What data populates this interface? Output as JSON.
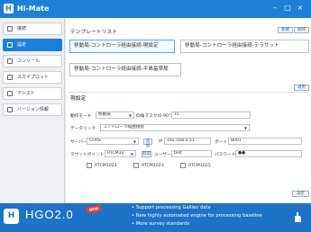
{
  "app": {
    "title": "Hi-Mate",
    "icon_label": "H"
  },
  "window_controls": {
    "minimize": "–",
    "maximize": "□",
    "close": "×"
  },
  "sidebar": {
    "items": [
      {
        "label": "接続"
      },
      {
        "label": "設定"
      },
      {
        "label": "コンソール"
      },
      {
        "label": "スカイプロット"
      },
      {
        "label": "アシスト"
      },
      {
        "label": "バージョン情報"
      }
    ]
  },
  "templates": {
    "title": "テンプレートリスト",
    "new_label": "新規",
    "delete_label": "削除",
    "items": [
      {
        "label": "移動局-コントローラ経由接続-現設定",
        "selected": true
      },
      {
        "label": "移動局-コントローラ経由接続-テラサット",
        "selected": false
      },
      {
        "label": "移動局-コントローラ経由接続-平島基準局",
        "selected": false
      }
    ],
    "apply_label": "適用"
  },
  "current_settings": {
    "title": "現設定",
    "work_mode_label": "動作モード",
    "work_mode_value": "移動局",
    "elevation_label": "仰角マスク(0-90°)",
    "elevation_value": "15",
    "datalink_label": "データリンク",
    "datalink_value": "コントローラ経由接続",
    "server_label": "サーバー",
    "server_value": "CORS",
    "add_label": "追加",
    "ip_label": "IP",
    "ip_value": "192.168.0.51",
    "port_label": "ポート",
    "port_value": "8001",
    "mountpoint_label": "マウントポイント",
    "mountpoint_value": "RTCM32",
    "get_label": "取得",
    "username_label": "ユーザー名",
    "username_value": "test",
    "password_label": "パスワード",
    "password_value": "●●",
    "checkboxes": [
      {
        "label": "RTCM1021"
      },
      {
        "label": "RTCM1023"
      },
      {
        "label": "RTCM1025"
      }
    ],
    "set_label": "設定"
  },
  "footer": {
    "logo_label": "H",
    "product": "HGO2.0",
    "badge": "NEW",
    "bullets": [
      "• Support processing Galileo data",
      "• New highly automated engine for processing baseline",
      "• More survey standards"
    ]
  }
}
